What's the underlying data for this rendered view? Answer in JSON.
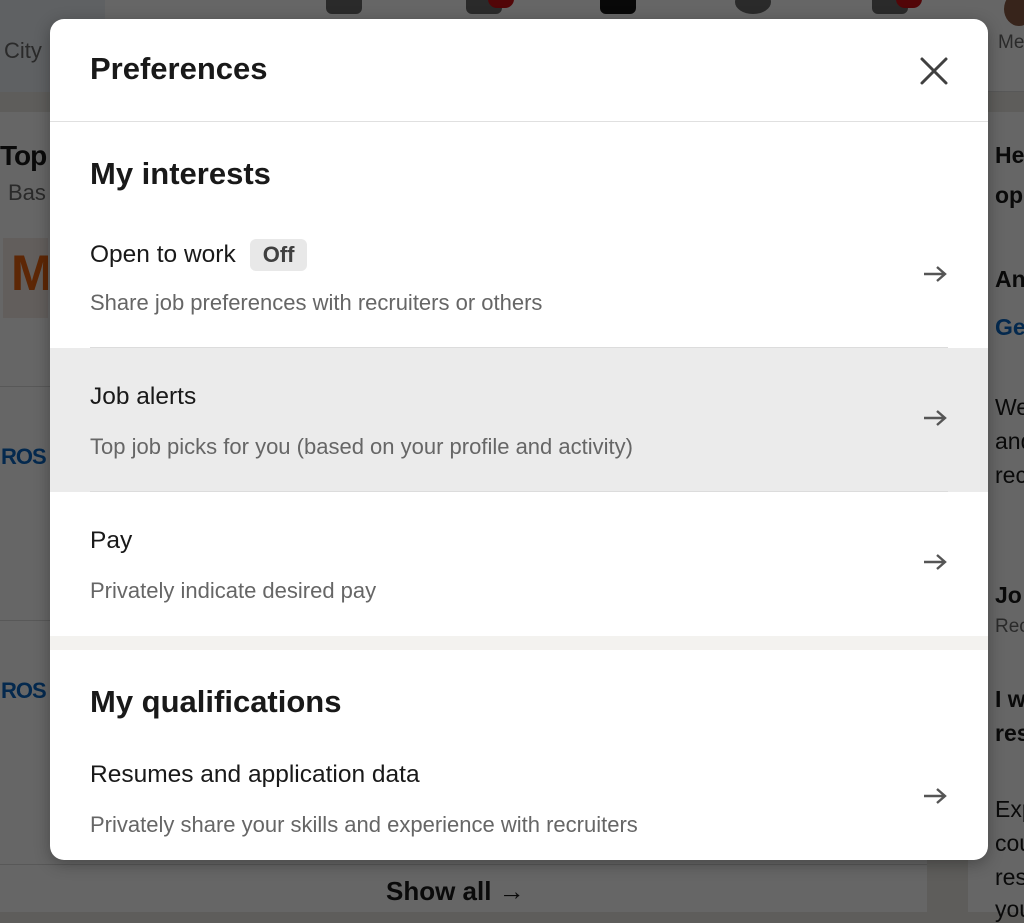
{
  "background": {
    "city_label": "City",
    "me_label": "Me",
    "left_title": "Top",
    "left_subtitle": "Bas",
    "logo_text": "M",
    "ros_1": "ROS",
    "ros_2": "ROS",
    "show_all": "Show all →",
    "right_texts": [
      "He",
      "op",
      "An",
      "Ge",
      "We",
      "and",
      "rec",
      "Jo",
      "Rec",
      "I w",
      "res",
      "Exp",
      "cou",
      "res",
      "you"
    ]
  },
  "modal": {
    "title": "Preferences",
    "close_icon": "close-icon",
    "sections": [
      {
        "title": "My interests"
      },
      {
        "title": "My qualifications"
      }
    ],
    "rows": [
      {
        "title": "Open to work",
        "badge": "Off",
        "description": "Share job preferences with recruiters or others"
      },
      {
        "title": "Job alerts",
        "description": "Top job picks for you (based on your profile and activity)"
      },
      {
        "title": "Pay",
        "description": "Privately indicate desired pay"
      },
      {
        "title": "Resumes and application data",
        "description": "Privately share your skills and experience with recruiters"
      }
    ],
    "arrow_icon": "arrow-right-icon",
    "highlight_color": "#ebebeb"
  }
}
